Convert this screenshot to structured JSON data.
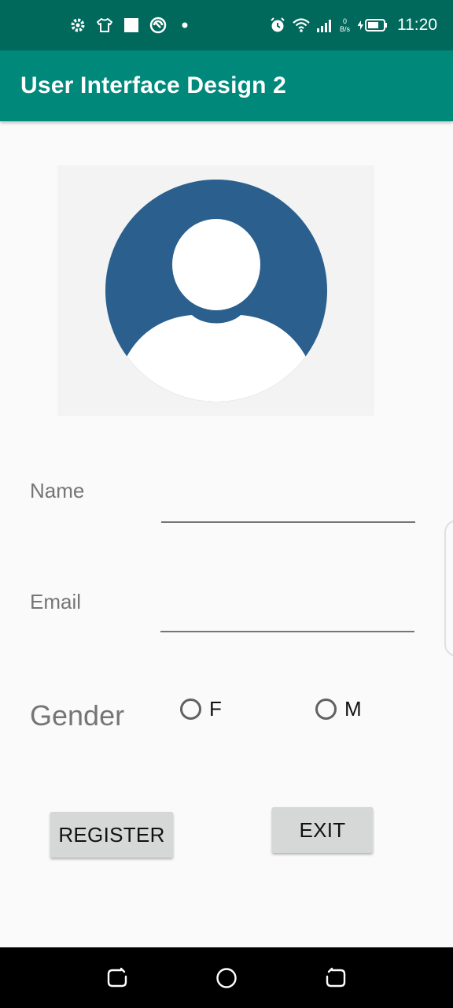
{
  "status_bar": {
    "time": "11:20",
    "net_speed_value": "0",
    "net_speed_unit": "B/s",
    "left_icons": [
      "gear-icon",
      "shirt-icon",
      "square-icon",
      "vpn-icon",
      "dot-icon"
    ],
    "right_icons": [
      "alarm-icon",
      "wifi-icon",
      "signal-icon",
      "battery-icon"
    ]
  },
  "app_bar": {
    "title": "User Interface Design 2",
    "color": "#00897b",
    "status_color": "#00695c"
  },
  "avatar": {
    "icon": "user-avatar-icon",
    "circle_color": "#2b5f8e"
  },
  "form": {
    "name_label": "Name",
    "name_value": "",
    "email_label": "Email",
    "email_value": "",
    "gender_label": "Gender",
    "gender_options": [
      "F",
      "M"
    ]
  },
  "buttons": {
    "register": "REGISTER",
    "exit": "EXIT"
  },
  "nav_bar": {
    "icons": [
      "back-icon",
      "home-icon",
      "recents-icon"
    ]
  }
}
